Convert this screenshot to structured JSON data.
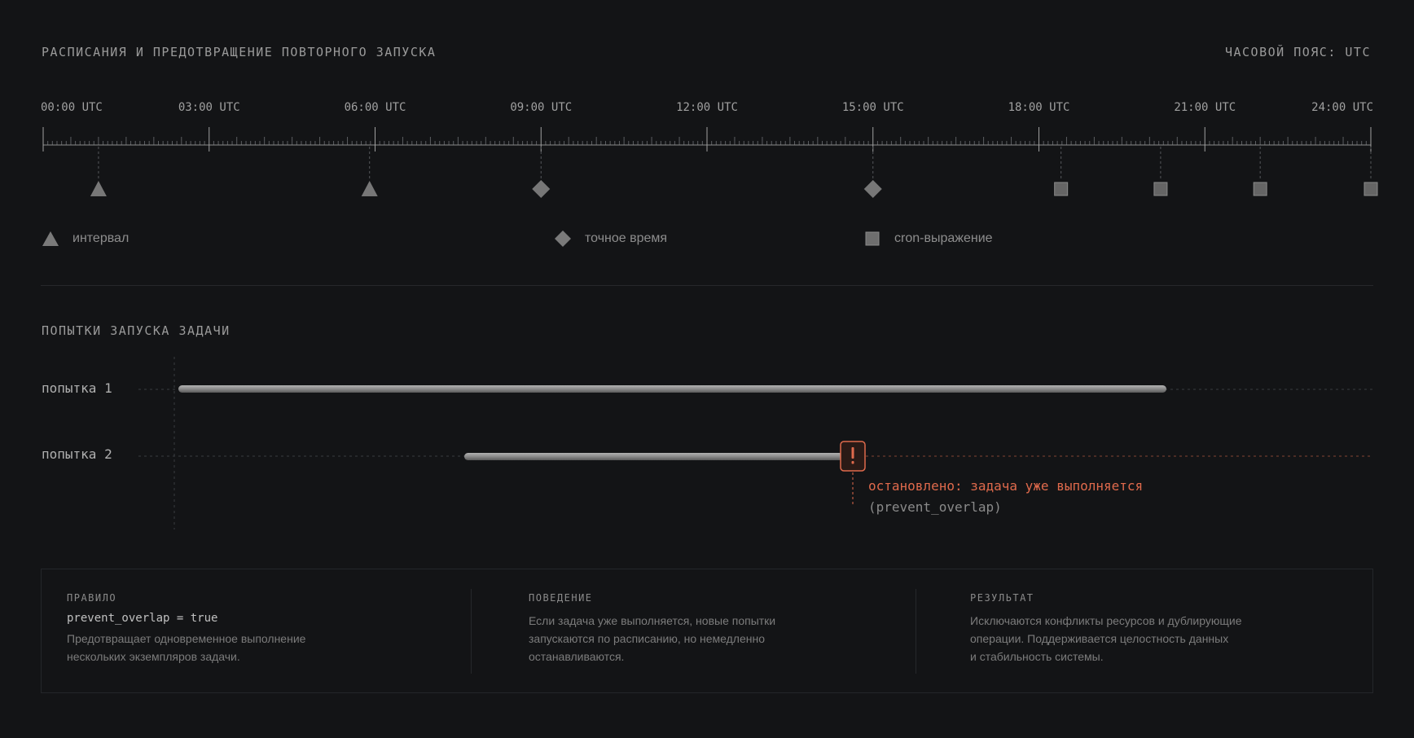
{
  "header": {
    "title": "РАСПИСАНИЯ И ПРЕДОТВРАЩЕНИЕ ПОВТОРНОГО ЗАПУСКА",
    "timezone": "ЧАСОВОЙ ПОЯС: UTC"
  },
  "timeline": {
    "ticks": [
      "00:00 UTC",
      "03:00 UTC",
      "06:00 UTC",
      "09:00 UTC",
      "12:00 UTC",
      "15:00 UTC",
      "18:00 UTC",
      "21:00 UTC",
      "24:00 UTC"
    ],
    "events": [
      {
        "hour": 1.0,
        "kind": "interval"
      },
      {
        "hour": 5.9,
        "kind": "interval"
      },
      {
        "hour": 9.0,
        "kind": "exact"
      },
      {
        "hour": 15.0,
        "kind": "exact"
      },
      {
        "hour": 18.4,
        "kind": "cron"
      },
      {
        "hour": 20.2,
        "kind": "cron"
      },
      {
        "hour": 22.0,
        "kind": "cron"
      },
      {
        "hour": 24.0,
        "kind": "cron"
      }
    ],
    "colors": {
      "marker": "#777777",
      "axis": "#8a8a8a"
    }
  },
  "legend": {
    "interval": {
      "label": "интервал",
      "icon": "triangle-icon"
    },
    "exact": {
      "label": "точное время",
      "icon": "diamond-icon"
    },
    "cron": {
      "label": "cron-выражение",
      "icon": "square-icon"
    }
  },
  "runs": {
    "title": "ПОПЫТКИ ЗАПУСКА ЗАДАЧИ",
    "attempts": [
      {
        "label": "попытка 1",
        "status": "completed"
      },
      {
        "label": "попытка 2",
        "status": "stopped"
      }
    ],
    "stop_message": "остановлено: задача уже выполняется",
    "stop_code": "(prevent_overlap)",
    "alert_icon": "exclamation-icon",
    "colors": {
      "alert": "#e06a4c",
      "bar": "#8f8f8f"
    }
  },
  "info": {
    "rule": {
      "heading": "ПРАВИЛО",
      "code": "prevent_overlap = true",
      "lines": [
        "Предотвращает одновременное выполнение",
        "нескольких экземпляров задачи."
      ]
    },
    "behavior": {
      "heading": "ПОВЕДЕНИЕ",
      "lines": [
        "Если задача уже выполняется, новые попытки",
        "запускаются по расписанию, но немедленно",
        "останавливаются."
      ]
    },
    "result": {
      "heading": "РЕЗУЛЬТАТ",
      "lines": [
        "Исключаются конфликты ресурсов и дублирующие",
        "операции. Поддерживается целостность данных",
        "и стабильность системы."
      ]
    }
  }
}
